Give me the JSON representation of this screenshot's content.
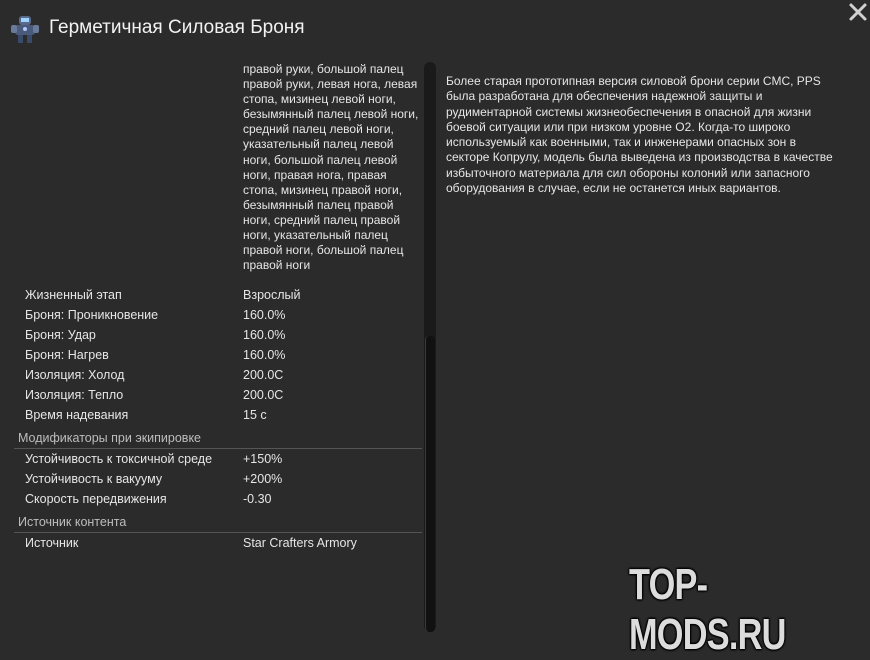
{
  "window": {
    "title": "Герметичная Силовая Броня",
    "icon": "power-armor-icon",
    "close_icon": "close-icon"
  },
  "stats": {
    "body_parts_wrapped": "правой руки, большой палец правой руки, левая нога, левая стопа, мизинец левой ноги, безымянный палец левой ноги, средний палец левой ноги, указательный палец левой ноги, большой палец левой ноги, правая нога, правая стопа, мизинец правой ноги, безымянный палец правой ноги, средний палец правой ноги, указательный палец правой ноги, большой палец правой ноги",
    "rows": [
      {
        "key": "Жизненный этап",
        "value": "Взрослый"
      },
      {
        "key": "Броня: Проникновение",
        "value": "160.0%"
      },
      {
        "key": "Броня: Удар",
        "value": "160.0%"
      },
      {
        "key": "Броня: Нагрев",
        "value": "160.0%"
      },
      {
        "key": "Изоляция: Холод",
        "value": "200.0C"
      },
      {
        "key": "Изоляция: Тепло",
        "value": "200.0C"
      },
      {
        "key": "Время надевания",
        "value": "15 с"
      }
    ],
    "equip_section": "Модификаторы при экипировке",
    "equip_rows": [
      {
        "key": "Устойчивость к токсичной среде",
        "value": "+150%"
      },
      {
        "key": "Устойчивость к вакууму",
        "value": "+200%"
      },
      {
        "key": "Скорость передвижения",
        "value": "-0.30"
      }
    ],
    "source_section": "Источник контента",
    "source_rows": [
      {
        "key": "Источник",
        "value": "Star Crafters Armory"
      }
    ]
  },
  "description": "Более старая прототипная версия силовой брони серии СМС, PPS была разработана для обеспечения надежной защиты и рудиментарной системы жизнеобеспечения в опасной для жизни боевой ситуации или при низком уровне О2. Когда-то широко используемый как военными, так и инженерами опасных зон в секторе Копрулу, модель была выведена из производства в качестве избыточного материала для сил обороны колоний или запасного оборудования в случае, если не останется иных вариантов.",
  "watermark": "TOP-MODS.RU",
  "colors": {
    "background": "#2b2b2b",
    "text": "#e6e6e6",
    "section_text": "#bdbdbd"
  }
}
